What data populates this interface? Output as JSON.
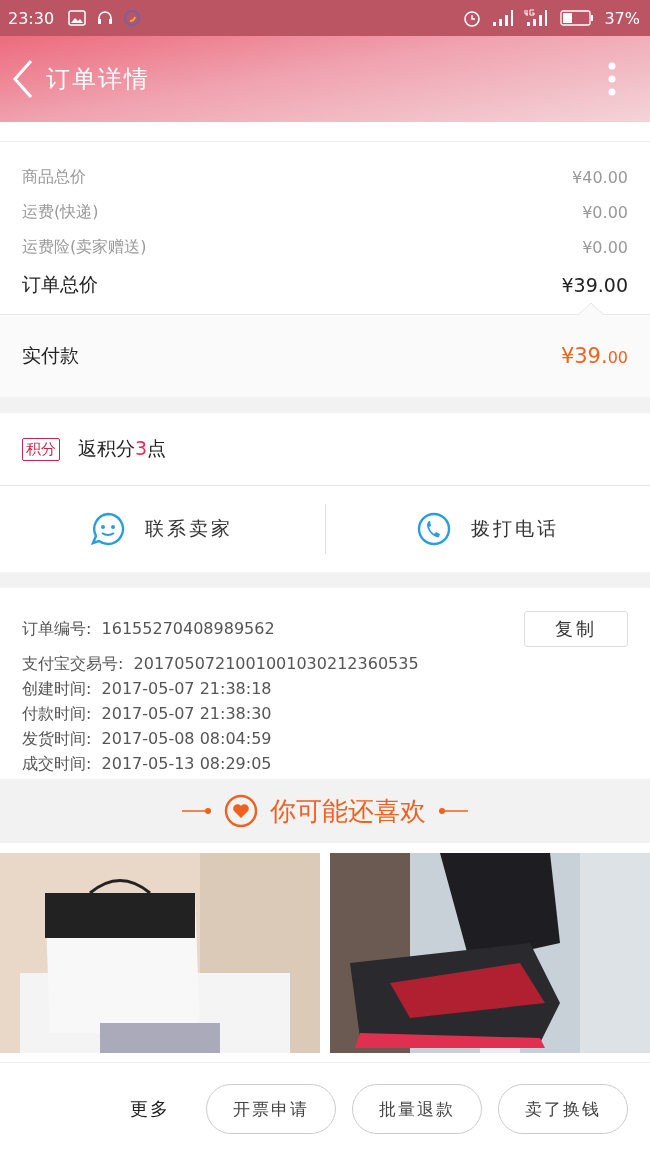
{
  "status_bar": {
    "time": "23:30",
    "battery_percent": "37%"
  },
  "header": {
    "title": "订单详情"
  },
  "price_rows": [
    {
      "label": "商品总价",
      "value": "¥40.00",
      "kind": "minor"
    },
    {
      "label": "运费(快递)",
      "value": "¥0.00",
      "kind": "minor"
    },
    {
      "label": "运费险(卖家赠送)",
      "value": "¥0.00",
      "kind": "minor"
    },
    {
      "label": "订单总价",
      "value": "¥39.00",
      "kind": "total"
    }
  ],
  "paid": {
    "label": "实付款",
    "value_main": "¥39.",
    "value_cents": "00"
  },
  "points": {
    "badge": "积分",
    "text_before": "返积分",
    "number": "3",
    "text_after": "点"
  },
  "contact_buttons": [
    {
      "label": "联系卖家",
      "kind": "chat"
    },
    {
      "label": "拨打电话",
      "kind": "phone"
    }
  ],
  "order_info": [
    {
      "label": "订单编号:",
      "value": "16155270408989562",
      "kind": "copyable"
    },
    {
      "label": "支付宝交易号:",
      "value": "2017050721001001030212360535",
      "kind": "plain"
    },
    {
      "label": "创建时间:",
      "value": "2017-05-07 21:38:18",
      "kind": "plain"
    },
    {
      "label": "付款时间:",
      "value": "2017-05-07 21:38:30",
      "kind": "plain"
    },
    {
      "label": "发货时间:",
      "value": "2017-05-08 08:04:59",
      "kind": "plain"
    },
    {
      "label": "成交时间:",
      "value": "2017-05-13 08:29:05",
      "kind": "plain"
    }
  ],
  "copy_button": "复制",
  "recommend": {
    "title": "你可能还喜欢"
  },
  "bottom_bar": {
    "more": "更多",
    "buttons": [
      "开票申请",
      "批量退款",
      "卖了换钱"
    ]
  }
}
